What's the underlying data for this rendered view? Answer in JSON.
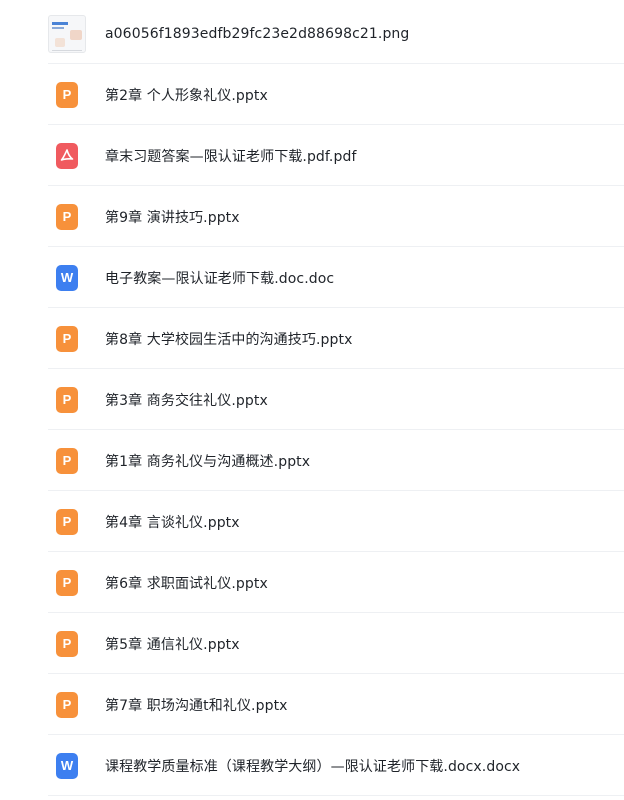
{
  "files": [
    {
      "name": "a06056f1893edfb29fc23e2d88698c21.png",
      "type": "image",
      "icon": "image-thumbnail-icon"
    },
    {
      "name": "第2章 个人形象礼仪.pptx",
      "type": "pptx",
      "icon": "ppt-file-icon"
    },
    {
      "name": "章末习题答案—限认证老师下载.pdf.pdf",
      "type": "pdf",
      "icon": "pdf-file-icon"
    },
    {
      "name": "第9章 演讲技巧.pptx",
      "type": "pptx",
      "icon": "ppt-file-icon"
    },
    {
      "name": "电子教案—限认证老师下载.doc.doc",
      "type": "doc",
      "icon": "word-file-icon"
    },
    {
      "name": "第8章 大学校园生活中的沟通技巧.pptx",
      "type": "pptx",
      "icon": "ppt-file-icon"
    },
    {
      "name": "第3章 商务交往礼仪.pptx",
      "type": "pptx",
      "icon": "ppt-file-icon"
    },
    {
      "name": "第1章 商务礼仪与沟通概述.pptx",
      "type": "pptx",
      "icon": "ppt-file-icon"
    },
    {
      "name": "第4章 言谈礼仪.pptx",
      "type": "pptx",
      "icon": "ppt-file-icon"
    },
    {
      "name": "第6章 求职面试礼仪.pptx",
      "type": "pptx",
      "icon": "ppt-file-icon"
    },
    {
      "name": "第5章 通信礼仪.pptx",
      "type": "pptx",
      "icon": "ppt-file-icon"
    },
    {
      "name": "第7章 职场沟通t和礼仪.pptx",
      "type": "pptx",
      "icon": "ppt-file-icon"
    },
    {
      "name": "课程教学质量标准（课程教学大纲）—限认证老师下载.docx.docx",
      "type": "docx",
      "icon": "word-file-icon"
    }
  ],
  "colors": {
    "ppt": "#f7913b",
    "pdf": "#f05a5f",
    "word": "#3d7ff0",
    "text": "#1f2329",
    "divider": "#eef0f3"
  }
}
